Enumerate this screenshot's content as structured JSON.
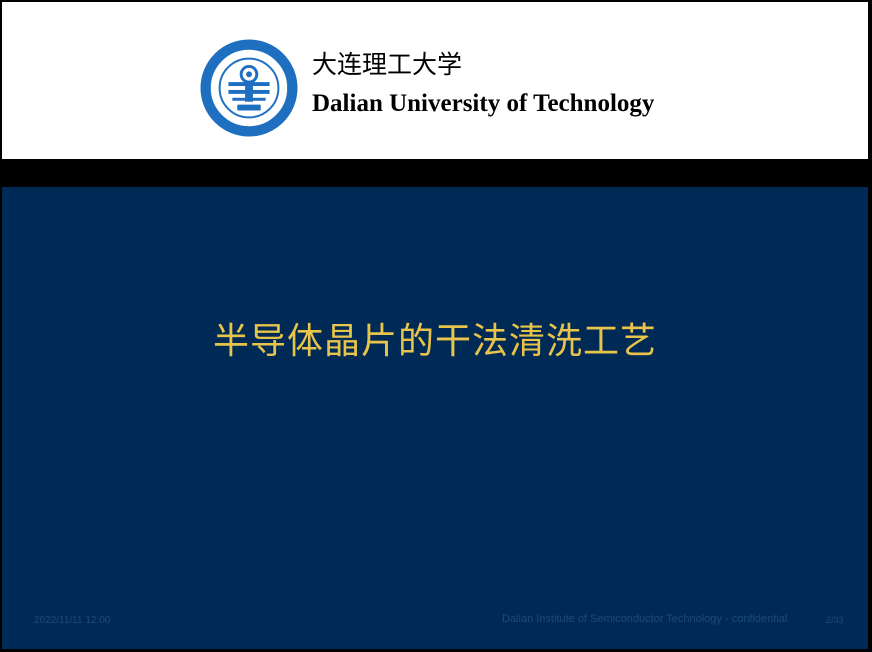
{
  "header": {
    "university_cn": "大连理工大学",
    "university_en": "Dalian University of Technology",
    "logo": {
      "icon": "university-seal-icon",
      "color": "#1f6fc0"
    }
  },
  "slide": {
    "title": "半导体晶片的干法清洗工艺",
    "title_color": "#e9c44a",
    "background": "#002a56"
  },
  "footer": {
    "date": "2022/11/11 12:00",
    "note": "Dalian Institute of Semiconductor Technology - confidential",
    "page": "2/33"
  }
}
